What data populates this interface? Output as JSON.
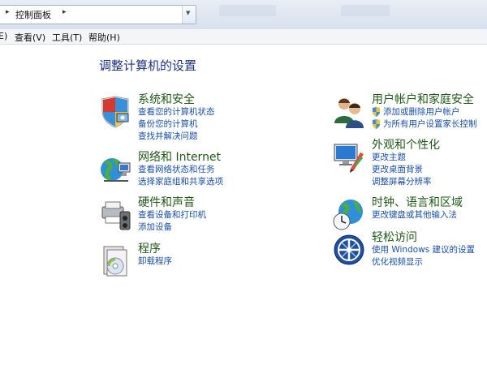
{
  "address_bar": {
    "path_label": "控制面板",
    "arrow": "▸",
    "arrow_after": "▸"
  },
  "menu": {
    "items": [
      "E)",
      "查看(V)",
      "工具(T)",
      "帮助(H)"
    ]
  },
  "page_title": "调整计算机的设置",
  "categories": [
    {
      "title": "系统和安全",
      "icon": "system-security-icon",
      "links": [
        "查看您的计算机状态",
        "备份您的计算机",
        "查找并解决问题"
      ]
    },
    {
      "title": "网络和 Internet",
      "icon": "network-icon",
      "links": [
        "查看网络状态和任务",
        "选择家庭组和共享选项"
      ]
    },
    {
      "title": "硬件和声音",
      "icon": "hardware-sound-icon",
      "links": [
        "查看设备和打印机",
        "添加设备"
      ]
    },
    {
      "title": "程序",
      "icon": "programs-icon",
      "links": [
        "卸载程序"
      ]
    },
    {
      "title": "用户帐户和家庭安全",
      "icon": "user-accounts-icon",
      "links": [
        "添加或删除用户帐户",
        "为所有用户设置家长控制"
      ]
    },
    {
      "title": "外观和个性化",
      "icon": "appearance-icon",
      "links": [
        "更改主题",
        "更改桌面背景",
        "调整屏幕分辨率"
      ]
    },
    {
      "title": "时钟、语言和区域",
      "icon": "clock-language-icon",
      "links": [
        "更改键盘或其他输入法"
      ]
    },
    {
      "title": "轻松访问",
      "icon": "ease-of-access-icon",
      "links": [
        "使用 Windows 建议的设置",
        "优化视频显示"
      ]
    }
  ],
  "colors": {
    "title_blue": "#1e3287",
    "category_green": "#1e5a16",
    "link_blue": "#1a4fa8"
  }
}
